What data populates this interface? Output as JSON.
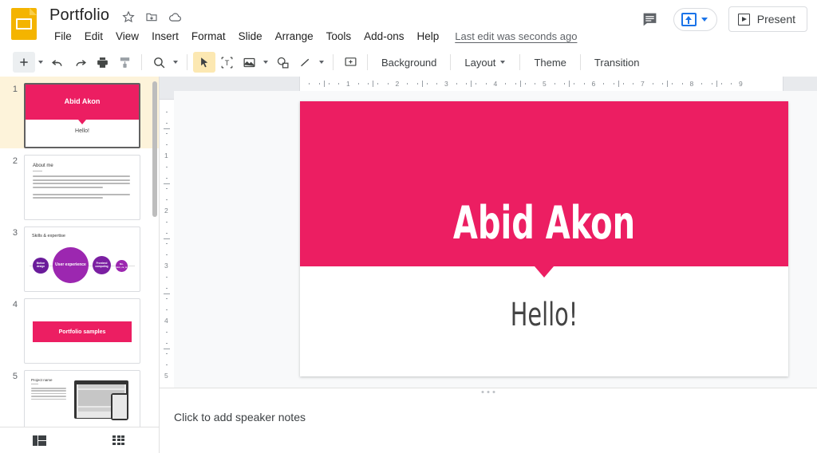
{
  "app": {
    "logo_icon": "google-slides-logo",
    "document_title": "Portfolio",
    "title_icons": [
      "star-icon",
      "move-to-folder-icon",
      "cloud-saved-icon"
    ],
    "last_edit": "Last edit was seconds ago"
  },
  "menubar": {
    "items": [
      "File",
      "Edit",
      "View",
      "Insert",
      "Format",
      "Slide",
      "Arrange",
      "Tools",
      "Add-ons",
      "Help"
    ]
  },
  "topright": {
    "comment_icon": "comment-icon",
    "share_icon": "share-upload-icon",
    "share_caret": "chevron-down-icon",
    "present_label": "Present",
    "present_icon": "present-play-icon"
  },
  "toolbar": {
    "new_slide_icon": "plus-icon",
    "new_slide_caret": "chevron-down-icon",
    "undo_icon": "undo-icon",
    "redo_icon": "redo-icon",
    "print_icon": "print-icon",
    "paint_format_icon": "paint-format-icon",
    "zoom_icon": "zoom-icon",
    "zoom_caret": "chevron-down-icon",
    "select_icon": "cursor-select-icon",
    "textbox_icon": "text-box-icon",
    "image_icon": "insert-image-icon",
    "image_caret": "chevron-down-icon",
    "shape_icon": "shape-icon",
    "line_icon": "line-icon",
    "line_caret": "chevron-down-icon",
    "comment_add_icon": "add-comment-icon",
    "background_label": "Background",
    "layout_label": "Layout",
    "layout_caret": "chevron-down-icon",
    "theme_label": "Theme",
    "transition_label": "Transition"
  },
  "filmstrip": {
    "slides": [
      {
        "number": "1",
        "active": true,
        "title": "Abid Akon",
        "subtitle": "Hello!"
      },
      {
        "number": "2",
        "active": false,
        "title": "About me"
      },
      {
        "number": "3",
        "active": false,
        "title": "Skills & expertise",
        "bubbles": [
          "Motion design",
          "User experience",
          "Frontend computing",
          "Mo-tion_ce_ic"
        ]
      },
      {
        "number": "4",
        "active": false,
        "title": "Portfolio samples"
      },
      {
        "number": "5",
        "active": false,
        "title": "Project name"
      }
    ]
  },
  "view_switcher": {
    "filmstrip_icon": "filmstrip-view-icon",
    "grid_icon": "grid-view-icon"
  },
  "rulers": {
    "horizontal_ticks": [
      "1",
      "2",
      "3",
      "4",
      "5",
      "6",
      "7",
      "8",
      "9"
    ],
    "vertical_ticks": [
      "1",
      "2",
      "3",
      "4",
      "5"
    ]
  },
  "slide": {
    "title": "Abid Akon",
    "subtitle": "Hello!",
    "accent_color": "#EC1E62",
    "background_color": "#FFFFFF",
    "title_color": "#FFFFFF",
    "subtitle_color": "#444444"
  },
  "notes": {
    "placeholder": "Click to add speaker notes",
    "resize_handle_icon": "drag-handle-dots-icon"
  }
}
